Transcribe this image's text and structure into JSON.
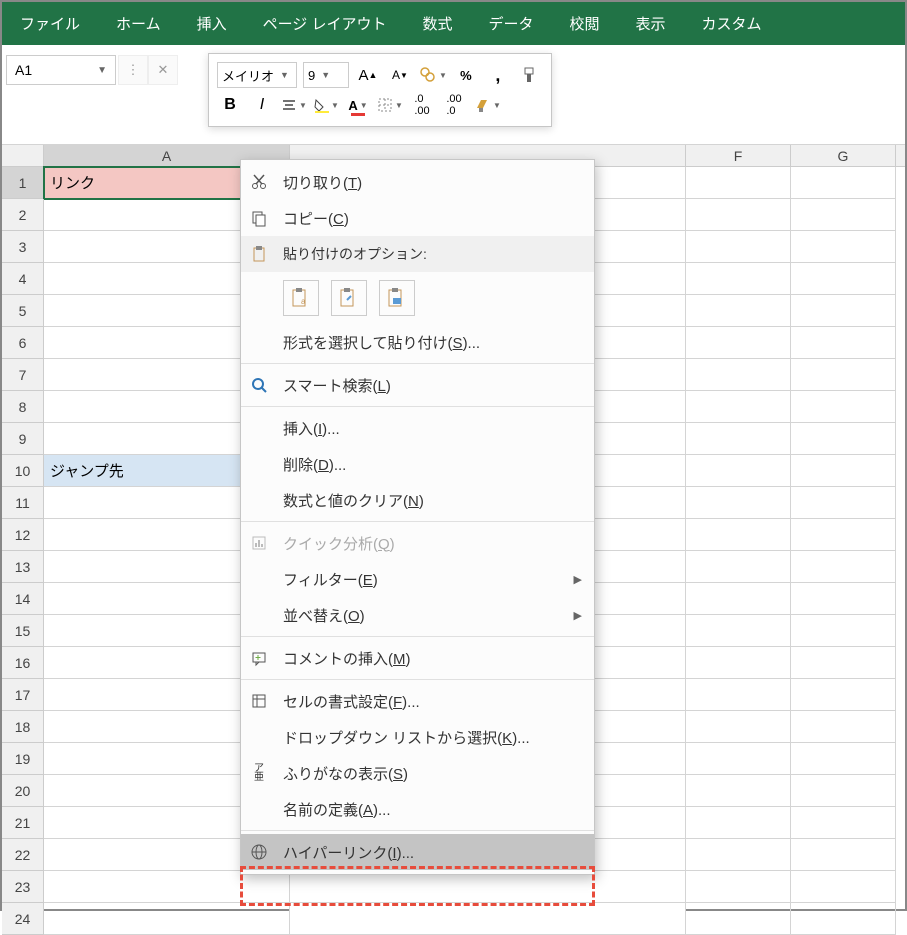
{
  "ribbon": {
    "tabs": [
      "ファイル",
      "ホーム",
      "挿入",
      "ページ レイアウト",
      "数式",
      "データ",
      "校閲",
      "表示",
      "カスタム"
    ]
  },
  "namebox": {
    "value": "A1"
  },
  "miniToolbar": {
    "font": "メイリオ",
    "size": "9"
  },
  "columns": [
    "A",
    "F",
    "G"
  ],
  "cells": {
    "A1": "リンク",
    "A10": "ジャンプ先"
  },
  "rowCount": 24,
  "contextMenu": {
    "cut": "切り取り(T)",
    "copy": "コピー(C)",
    "pasteHeader": "貼り付けのオプション:",
    "pasteSpecial": "形式を選択して貼り付け(S)...",
    "smartLookup": "スマート検索(L)",
    "insert": "挿入(I)...",
    "delete": "削除(D)...",
    "clearContents": "数式と値のクリア(N)",
    "quickAnalysis": "クイック分析(Q)",
    "filter": "フィルター(E)",
    "sort": "並べ替え(O)",
    "insertComment": "コメントの挿入(M)",
    "formatCells": "セルの書式設定(F)...",
    "pickFromList": "ドロップダウン リストから選択(K)...",
    "showPhonetic": "ふりがなの表示(S)",
    "defineName": "名前の定義(A)...",
    "hyperlink": "ハイパーリンク(I)..."
  }
}
